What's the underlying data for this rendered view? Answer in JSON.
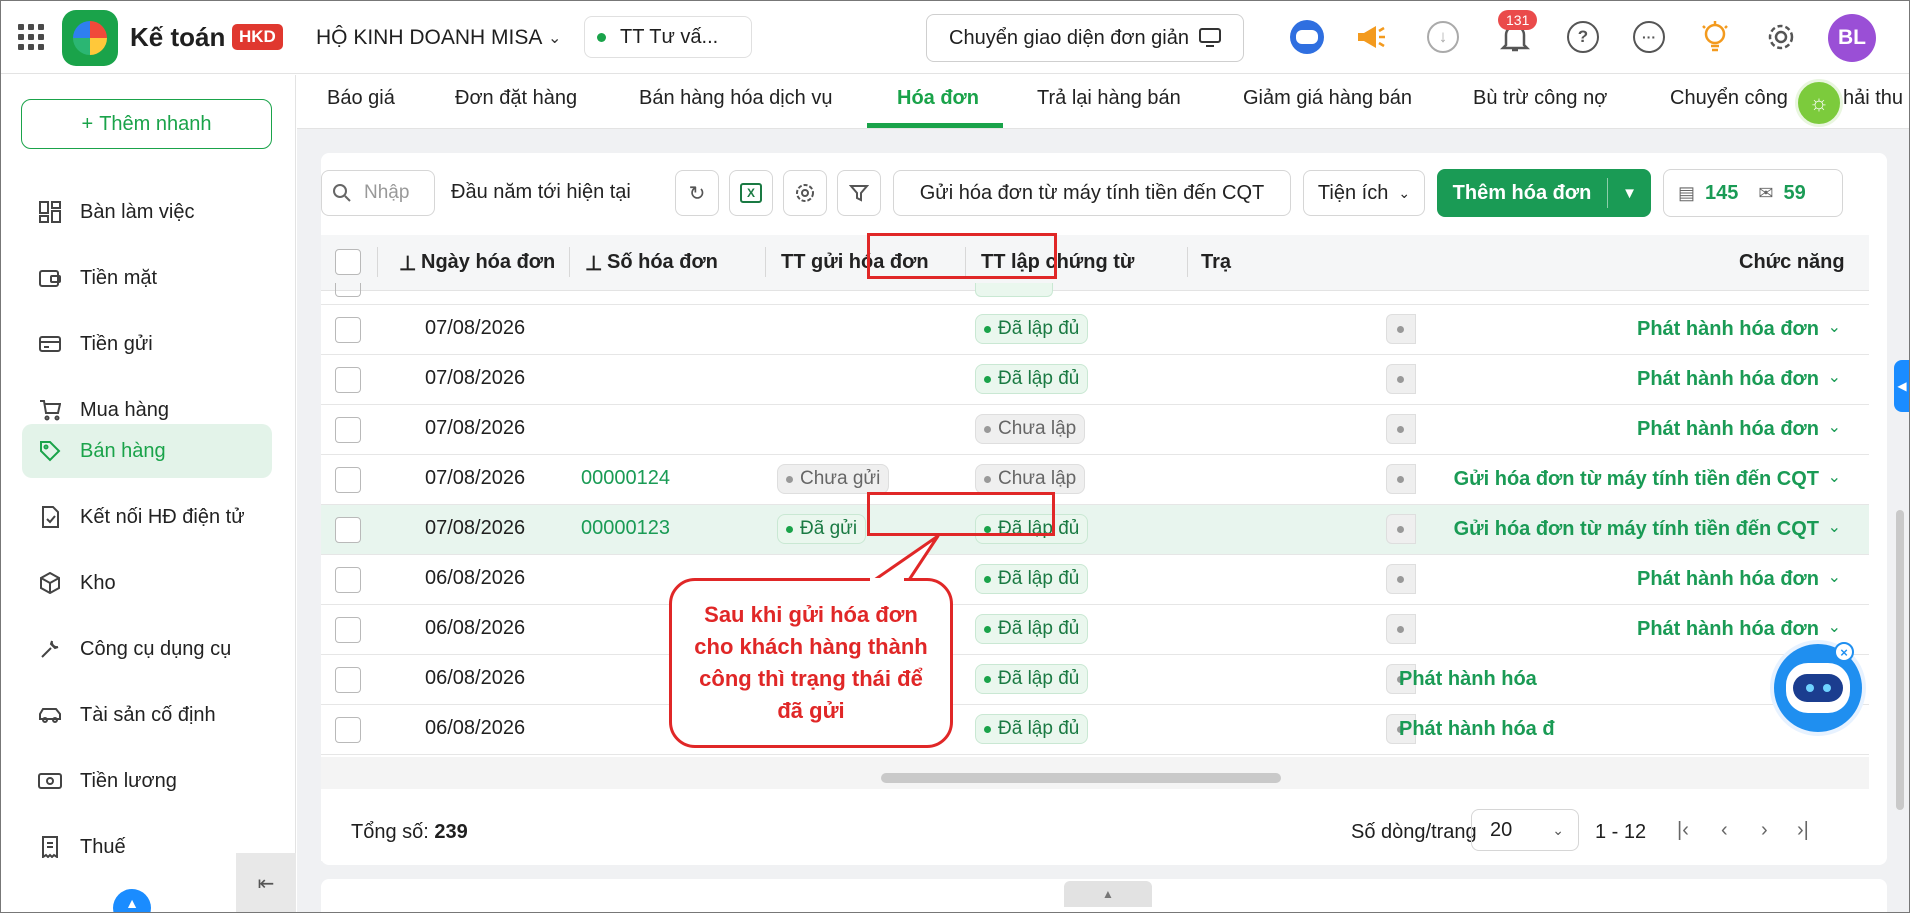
{
  "app": {
    "name": "Kế toán",
    "badge": "HKD",
    "company": "HỘ KINH DOANH MISA",
    "status": "TT Tư vấ...",
    "simple_mode": "Chuyển giao diện đơn giản",
    "notif_count": "131",
    "avatar": "BL"
  },
  "sidebar": {
    "quick_add": "Thêm nhanh",
    "items": [
      {
        "label": "Bàn làm việc",
        "icon": "dashboard-icon"
      },
      {
        "label": "Tiền mặt",
        "icon": "wallet-icon"
      },
      {
        "label": "Tiền gửi",
        "icon": "bank-card-icon"
      },
      {
        "label": "Mua hàng",
        "icon": "cart-icon"
      },
      {
        "label": "Bán hàng",
        "icon": "tag-icon"
      },
      {
        "label": "Kết nối HĐ điện tử",
        "icon": "e-invoice-icon"
      },
      {
        "label": "Kho",
        "icon": "box-icon"
      },
      {
        "label": "Công cụ dụng cụ",
        "icon": "tools-icon"
      },
      {
        "label": "Tài sản cố định",
        "icon": "car-icon"
      },
      {
        "label": "Tiền lương",
        "icon": "money-icon"
      },
      {
        "label": "Thuế",
        "icon": "tax-receipt-icon"
      }
    ]
  },
  "tabs": [
    "Báo giá",
    "Đơn đặt hàng",
    "Bán hàng hóa dịch vụ",
    "Hóa đơn",
    "Trả lại hàng bán",
    "Giảm giá hàng bán",
    "Bù trừ công nợ",
    "Chuyển công",
    "hải thu"
  ],
  "toolbar": {
    "search_placeholder": "Nhập",
    "period": "Đầu năm tới hiện tại",
    "send_btn": "Gửi hóa đơn từ máy tính tiền đến CQT",
    "utility": "Tiện ích",
    "add": "Thêm hóa đơn",
    "count_docs": "145",
    "count_mail": "59"
  },
  "table": {
    "headers": [
      "Ngày hóa đơn",
      "Số hóa đơn",
      "TT gửi hóa đơn",
      "TT lập chứng từ",
      "Trạ",
      "Chức năng"
    ],
    "rows": [
      {
        "date": "07/08/2026",
        "no": "",
        "send": "",
        "doc": "Đã lập đủ",
        "action": "Phát hành hóa đơn"
      },
      {
        "date": "07/08/2026",
        "no": "",
        "send": "",
        "doc": "Đã lập đủ",
        "action": "Phát hành hóa đơn"
      },
      {
        "date": "07/08/2026",
        "no": "",
        "send": "",
        "doc": "Chưa lập",
        "action": "Phát hành hóa đơn"
      },
      {
        "date": "07/08/2026",
        "no": "00000124",
        "send": "Chưa gửi",
        "doc": "Chưa lập",
        "action": "Gửi hóa đơn từ máy tính tiền đến CQT"
      },
      {
        "date": "07/08/2026",
        "no": "00000123",
        "send": "Đã gửi",
        "doc": "Đã lập đủ",
        "action": "Gửi hóa đơn từ máy tính tiền đến CQT"
      },
      {
        "date": "06/08/2026",
        "no": "",
        "send": "",
        "doc": "Đã lập đủ",
        "action": "Phát hành hóa đơn"
      },
      {
        "date": "06/08/2026",
        "no": "",
        "send": "",
        "doc": "Đã lập đủ",
        "action": "Phát hành hóa đơn"
      },
      {
        "date": "06/08/2026",
        "no": "",
        "send": "",
        "doc": "Đã lập đủ",
        "action": "Phát hành hóa"
      },
      {
        "date": "06/08/2026",
        "no": "",
        "send": "",
        "doc": "Đã lập đủ",
        "action": "Phát hành hóa đ"
      }
    ]
  },
  "footer": {
    "total_label": "Tổng số:",
    "total": "239",
    "per_page_label": "Số dòng/trang",
    "per_page": "20",
    "range": "1 - 12"
  },
  "callout": "Sau khi gửi hóa đơn cho khách hàng thành công thì trạng thái để đã gửi",
  "colors": {
    "brand_green": "#1a9b55",
    "annotation_red": "#e02727",
    "active_bg": "#e3f3e9"
  }
}
